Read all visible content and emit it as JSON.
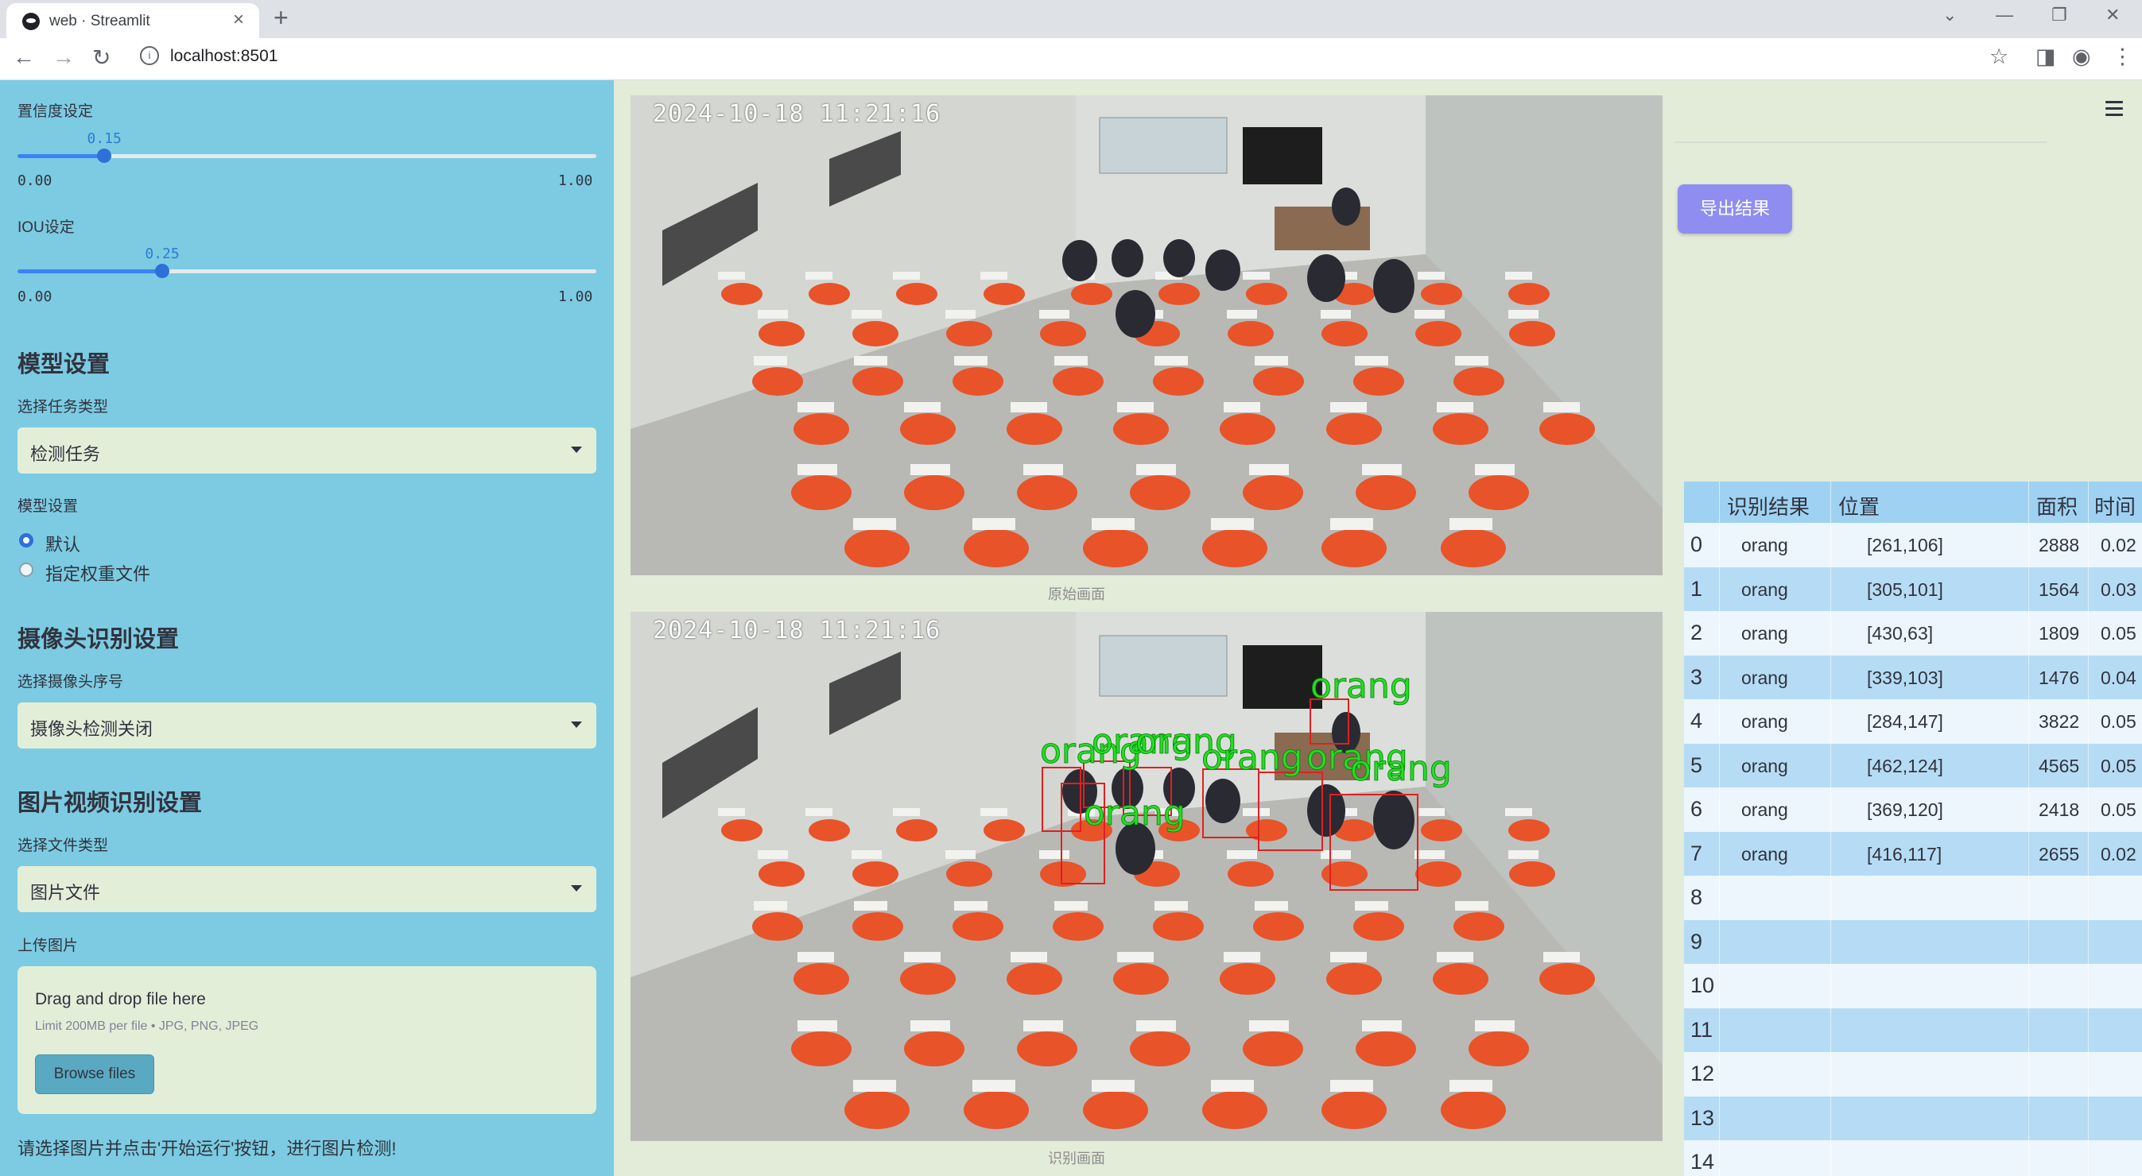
{
  "browser": {
    "tab_title": "web · Streamlit",
    "url": "localhost:8501",
    "close_glyph": "×",
    "new_tab_glyph": "+",
    "back_glyph": "←",
    "forward_glyph": "→",
    "reload_glyph": "↻",
    "info_glyph": "i",
    "star_glyph": "☆",
    "sidepanel_glyph": "◨",
    "profile_glyph": "◉",
    "menu_glyph": "⋮",
    "min_glyph": "—",
    "restore_glyph": "❐",
    "winclose_glyph": "✕",
    "dropdown_glyph": "⌄"
  },
  "sidebar": {
    "confidence": {
      "label": "置信度设定",
      "value_text": "0.15",
      "value": 0.15,
      "min": "0.00",
      "max": "1.00"
    },
    "iou": {
      "label": "IOU设定",
      "value_text": "0.25",
      "value": 0.25,
      "min": "0.00",
      "max": "1.00"
    },
    "model_heading": "模型设置",
    "task_type_label": "选择任务类型",
    "task_type_value": "检测任务",
    "model_label": "模型设置",
    "model_options": [
      "默认",
      "指定权重文件"
    ],
    "model_selected": 0,
    "camera_heading": "摄像头识别设置",
    "camera_label": "选择摄像头序号",
    "camera_value": "摄像头检测关闭",
    "media_heading": "图片视频识别设置",
    "file_type_label": "选择文件类型",
    "file_type_value": "图片文件",
    "upload_label": "上传图片",
    "upload_title": "Drag and drop file here",
    "upload_limit": "Limit 200MB per file • JPG, PNG, JPEG",
    "browse_label": "Browse files",
    "hint": "请选择图片并点击'开始运行'按钮，进行图片检测!"
  },
  "main": {
    "timestamp": "2024-10-18  11:21:16",
    "original_caption": "原始画面",
    "detected_caption": "识别画面",
    "detection_labels": [
      "orang",
      "orang",
      "orang",
      "orang",
      "orang",
      "orang",
      "orang",
      "orang"
    ],
    "export_label": "导出结果"
  },
  "colors": {
    "sidebar_bg": "#7ccbe2",
    "main_bg": "#e3ebd9",
    "accent": "#8f8ef0",
    "box_red": "#e02020",
    "label_green": "#22e022",
    "table_header": "#9fd2f2"
  },
  "table": {
    "headers": [
      "识别结果",
      "位置",
      "面积",
      "时间"
    ],
    "rows": [
      {
        "idx": "0",
        "label": "orang",
        "pos": "[261,106]",
        "area": "2888",
        "time": "0.02"
      },
      {
        "idx": "1",
        "label": "orang",
        "pos": "[305,101]",
        "area": "1564",
        "time": "0.03"
      },
      {
        "idx": "2",
        "label": "orang",
        "pos": "[430,63]",
        "area": "1809",
        "time": "0.05"
      },
      {
        "idx": "3",
        "label": "orang",
        "pos": "[339,103]",
        "area": "1476",
        "time": "0.04"
      },
      {
        "idx": "4",
        "label": "orang",
        "pos": "[284,147]",
        "area": "3822",
        "time": "0.05"
      },
      {
        "idx": "5",
        "label": "orang",
        "pos": "[462,124]",
        "area": "4565",
        "time": "0.05"
      },
      {
        "idx": "6",
        "label": "orang",
        "pos": "[369,120]",
        "area": "2418",
        "time": "0.05"
      },
      {
        "idx": "7",
        "label": "orang",
        "pos": "[416,117]",
        "area": "2655",
        "time": "0.02"
      },
      {
        "idx": "8",
        "label": "",
        "pos": "",
        "area": "",
        "time": ""
      },
      {
        "idx": "9",
        "label": "",
        "pos": "",
        "area": "",
        "time": ""
      },
      {
        "idx": "10",
        "label": "",
        "pos": "",
        "area": "",
        "time": ""
      },
      {
        "idx": "11",
        "label": "",
        "pos": "",
        "area": "",
        "time": ""
      },
      {
        "idx": "12",
        "label": "",
        "pos": "",
        "area": "",
        "time": ""
      },
      {
        "idx": "13",
        "label": "",
        "pos": "",
        "area": "",
        "time": ""
      },
      {
        "idx": "14",
        "label": "",
        "pos": "",
        "area": "",
        "time": ""
      }
    ]
  }
}
